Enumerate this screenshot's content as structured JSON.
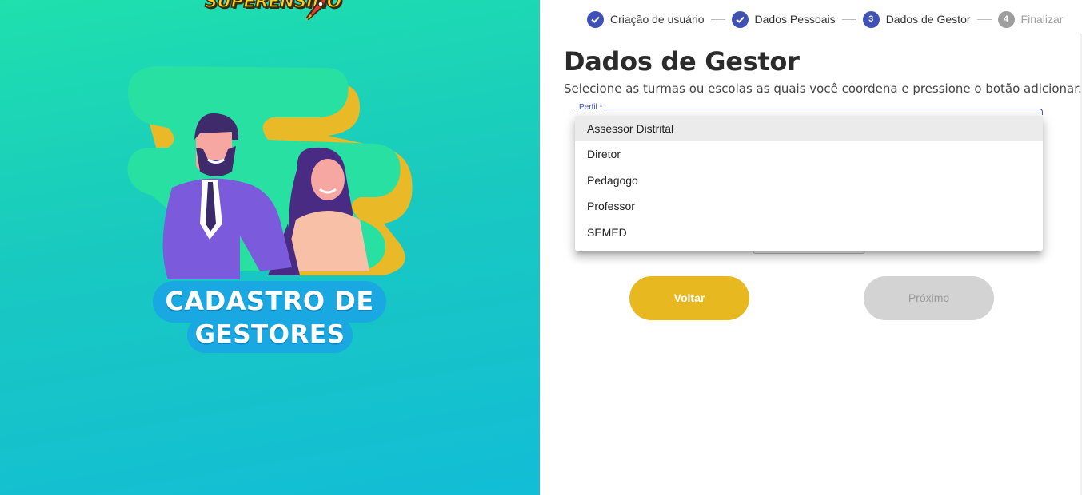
{
  "brand": {
    "logo_text": "SUPERENSINO"
  },
  "hero": {
    "banner_line1": "CADASTRO DE",
    "banner_line2": "GESTORES"
  },
  "stepper": {
    "steps": [
      {
        "label": "Criação de usuário",
        "state": "completed",
        "number": ""
      },
      {
        "label": "Dados Pessoais",
        "state": "completed",
        "number": ""
      },
      {
        "label": "Dados de Gestor",
        "state": "active",
        "number": "3"
      },
      {
        "label": "Finalizar",
        "state": "inactive",
        "number": "4"
      }
    ]
  },
  "form": {
    "title": "Dados de Gestor",
    "subtitle": "Selecione as turmas ou escolas as quais você coordena e pressione o botão adicionar.",
    "profile_label": "Perfil *",
    "profile_options": [
      "Assessor Distrital",
      "Diretor",
      "Pedagogo",
      "Professor",
      "SEMED"
    ],
    "highlighted_option": "Assessor Distrital"
  },
  "actions": {
    "back_label": "Voltar",
    "next_label": "Próximo"
  },
  "colors": {
    "primary": "#3f51b5",
    "accent_yellow": "#e8b820",
    "disabled": "#d3d3d3",
    "gradient_start": "#1fe0ad",
    "gradient_end": "#12bdd6",
    "banner_blue": "#1aa8e2"
  },
  "icons": {
    "completed_step": "check-icon",
    "logo_mark": "rocket-icon"
  }
}
